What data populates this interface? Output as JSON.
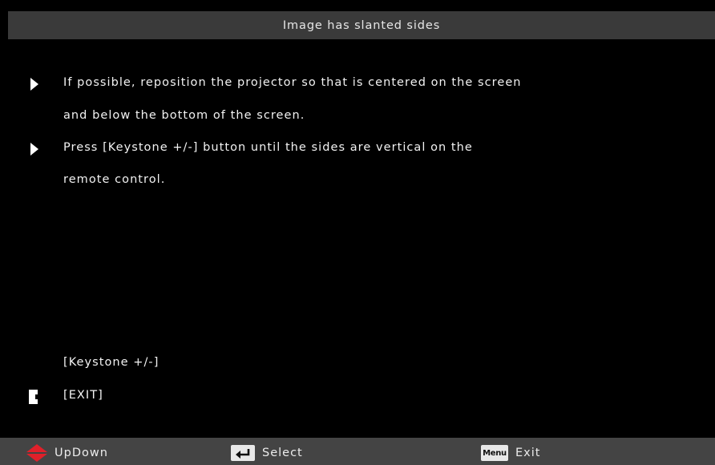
{
  "header": {
    "title": "Image has slanted sides"
  },
  "instructions": {
    "lines": [
      "If possible, reposition the projector so that is centered on the screen",
      "and below the bottom of the screen.",
      "Press [Keystone +/-] button until the sides are vertical on the",
      "remote control."
    ]
  },
  "keys": {
    "keystone_label": "[Keystone +/-]",
    "exit_label": "[EXIT]"
  },
  "footer": {
    "updown_label": "UpDown",
    "select_label": "Select",
    "menu_icon_text": "Menu",
    "exit_label": "Exit"
  },
  "colors": {
    "background": "#000000",
    "title_bar": "#3a3a3a",
    "footer_bar": "#444444",
    "updown_icon": "#e0202a"
  },
  "icons": {
    "bullet": "play-triangle-icon",
    "exit": "exit-key-icon",
    "updown": "updown-arrows-icon",
    "select": "enter-key-icon",
    "menu": "menu-key-icon"
  }
}
